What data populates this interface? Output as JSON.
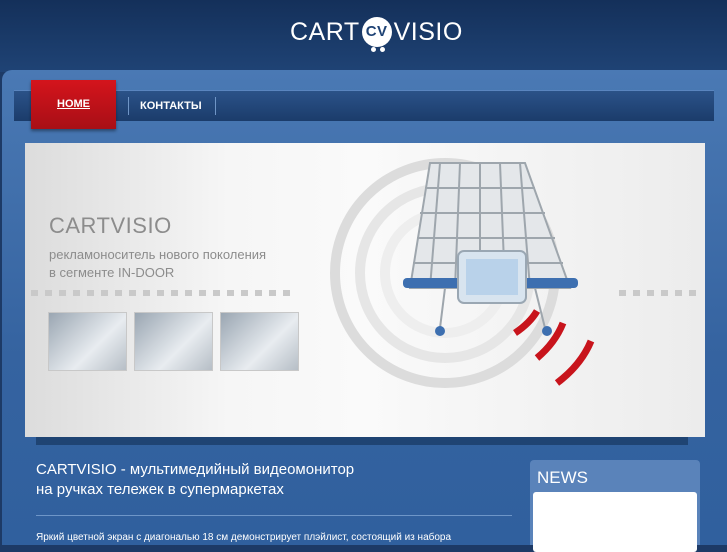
{
  "header": {
    "logo_left": "CART",
    "logo_badge": "CV",
    "logo_right": "VISIO"
  },
  "nav": {
    "items": [
      {
        "label": "HOME",
        "active": true
      },
      {
        "label": "КОНТАКТЫ",
        "active": false
      }
    ]
  },
  "banner": {
    "title": "CARTVISIO",
    "subtitle_line1": "рекламоноситель нового поколения",
    "subtitle_line2": "в сегменте IN-DOOR"
  },
  "content": {
    "title_line1": "CARTVISIO - мультимедийный видеомонитор",
    "title_line2": "на ручках тележек в супермаркетах",
    "body": "Яркий цветной экран с диагональю 18 см демонстрирует плэйлист, состоящий из набора"
  },
  "news": {
    "title": "NEWS"
  },
  "colors": {
    "brand_blue": "#1f4375",
    "accent_red": "#d4141c",
    "nav_bg": "#1b3c6b"
  }
}
